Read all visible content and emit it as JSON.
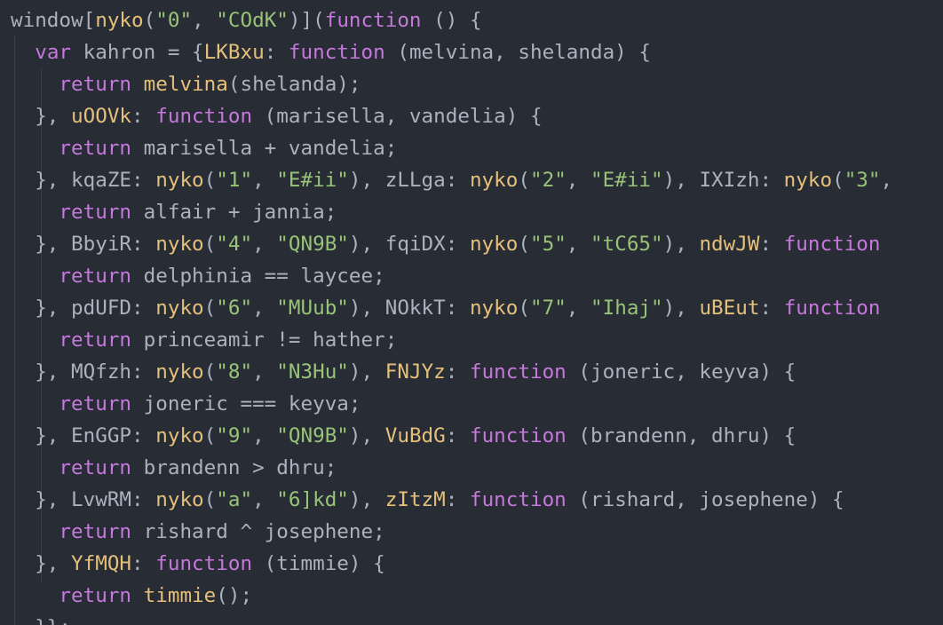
{
  "editor": {
    "language": "javascript",
    "theme_colors": {
      "background": "#282c34",
      "plain": "#abb2bf",
      "keyword": "#c678dd",
      "function_call": "#e5c07b",
      "string": "#98c379"
    },
    "lines": [
      [
        [
          "plain",
          "window["
        ],
        [
          "fn",
          "nyko"
        ],
        [
          "punc",
          "("
        ],
        [
          "str",
          "\"0\""
        ],
        [
          "punc",
          ", "
        ],
        [
          "str",
          "\"COdK\""
        ],
        [
          "punc",
          ")]("
        ],
        [
          "kw",
          "function"
        ],
        [
          "punc",
          " () {"
        ]
      ],
      [
        [
          "plain",
          "  "
        ],
        [
          "kw",
          "var"
        ],
        [
          "plain",
          " kahron = {"
        ],
        [
          "prop",
          "LKBxu"
        ],
        [
          "punc",
          ": "
        ],
        [
          "kw",
          "function"
        ],
        [
          "plain",
          " (melvina, shelanda) {"
        ]
      ],
      [
        [
          "plain",
          "    "
        ],
        [
          "kw",
          "return"
        ],
        [
          "plain",
          " "
        ],
        [
          "fn",
          "melvina"
        ],
        [
          "plain",
          "(shelanda);"
        ]
      ],
      [
        [
          "plain",
          "  }, "
        ],
        [
          "prop",
          "uOOVk"
        ],
        [
          "punc",
          ": "
        ],
        [
          "kw",
          "function"
        ],
        [
          "plain",
          " (marisella, vandelia) {"
        ]
      ],
      [
        [
          "plain",
          "    "
        ],
        [
          "kw",
          "return"
        ],
        [
          "plain",
          " marisella + vandelia;"
        ]
      ],
      [
        [
          "plain",
          "  }, kqaZE: "
        ],
        [
          "fn",
          "nyko"
        ],
        [
          "punc",
          "("
        ],
        [
          "str",
          "\"1\""
        ],
        [
          "punc",
          ", "
        ],
        [
          "str",
          "\"E#ii\""
        ],
        [
          "punc",
          "), zLLga: "
        ],
        [
          "fn",
          "nyko"
        ],
        [
          "punc",
          "("
        ],
        [
          "str",
          "\"2\""
        ],
        [
          "punc",
          ", "
        ],
        [
          "str",
          "\"E#ii\""
        ],
        [
          "punc",
          "), IXIzh: "
        ],
        [
          "fn",
          "nyko"
        ],
        [
          "punc",
          "("
        ],
        [
          "str",
          "\"3\""
        ],
        [
          "punc",
          ","
        ]
      ],
      [
        [
          "plain",
          "    "
        ],
        [
          "kw",
          "return"
        ],
        [
          "plain",
          " alfair + jannia;"
        ]
      ],
      [
        [
          "plain",
          "  }, BbyiR: "
        ],
        [
          "fn",
          "nyko"
        ],
        [
          "punc",
          "("
        ],
        [
          "str",
          "\"4\""
        ],
        [
          "punc",
          ", "
        ],
        [
          "str",
          "\"QN9B\""
        ],
        [
          "punc",
          "), fqiDX: "
        ],
        [
          "fn",
          "nyko"
        ],
        [
          "punc",
          "("
        ],
        [
          "str",
          "\"5\""
        ],
        [
          "punc",
          ", "
        ],
        [
          "str",
          "\"tC65\""
        ],
        [
          "punc",
          "), "
        ],
        [
          "prop",
          "ndwJW"
        ],
        [
          "punc",
          ": "
        ],
        [
          "kw",
          "function"
        ]
      ],
      [
        [
          "plain",
          "    "
        ],
        [
          "kw",
          "return"
        ],
        [
          "plain",
          " delphinia == laycee;"
        ]
      ],
      [
        [
          "plain",
          "  }, pdUFD: "
        ],
        [
          "fn",
          "nyko"
        ],
        [
          "punc",
          "("
        ],
        [
          "str",
          "\"6\""
        ],
        [
          "punc",
          ", "
        ],
        [
          "str",
          "\"MUub\""
        ],
        [
          "punc",
          "), NOkkT: "
        ],
        [
          "fn",
          "nyko"
        ],
        [
          "punc",
          "("
        ],
        [
          "str",
          "\"7\""
        ],
        [
          "punc",
          ", "
        ],
        [
          "str",
          "\"Ihaj\""
        ],
        [
          "punc",
          "), "
        ],
        [
          "prop",
          "uBEut"
        ],
        [
          "punc",
          ": "
        ],
        [
          "kw",
          "function"
        ]
      ],
      [
        [
          "plain",
          "    "
        ],
        [
          "kw",
          "return"
        ],
        [
          "plain",
          " princeamir != hather;"
        ]
      ],
      [
        [
          "plain",
          "  }, MQfzh: "
        ],
        [
          "fn",
          "nyko"
        ],
        [
          "punc",
          "("
        ],
        [
          "str",
          "\"8\""
        ],
        [
          "punc",
          ", "
        ],
        [
          "str",
          "\"N3Hu\""
        ],
        [
          "punc",
          "), "
        ],
        [
          "prop",
          "FNJYz"
        ],
        [
          "punc",
          ": "
        ],
        [
          "kw",
          "function"
        ],
        [
          "plain",
          " (joneric, keyva) {"
        ]
      ],
      [
        [
          "plain",
          "    "
        ],
        [
          "kw",
          "return"
        ],
        [
          "plain",
          " joneric === keyva;"
        ]
      ],
      [
        [
          "plain",
          "  }, EnGGP: "
        ],
        [
          "fn",
          "nyko"
        ],
        [
          "punc",
          "("
        ],
        [
          "str",
          "\"9\""
        ],
        [
          "punc",
          ", "
        ],
        [
          "str",
          "\"QN9B\""
        ],
        [
          "punc",
          "), "
        ],
        [
          "prop",
          "VuBdG"
        ],
        [
          "punc",
          ": "
        ],
        [
          "kw",
          "function"
        ],
        [
          "plain",
          " (brandenn, dhru) {"
        ]
      ],
      [
        [
          "plain",
          "    "
        ],
        [
          "kw",
          "return"
        ],
        [
          "plain",
          " brandenn > dhru;"
        ]
      ],
      [
        [
          "plain",
          "  }, LvwRM: "
        ],
        [
          "fn",
          "nyko"
        ],
        [
          "punc",
          "("
        ],
        [
          "str",
          "\"a\""
        ],
        [
          "punc",
          ", "
        ],
        [
          "str",
          "\"6]kd\""
        ],
        [
          "punc",
          "), "
        ],
        [
          "prop",
          "zItzM"
        ],
        [
          "punc",
          ": "
        ],
        [
          "kw",
          "function"
        ],
        [
          "plain",
          " (rishard, josephene) {"
        ]
      ],
      [
        [
          "plain",
          "    "
        ],
        [
          "kw",
          "return"
        ],
        [
          "plain",
          " rishard ^ josephene;"
        ]
      ],
      [
        [
          "plain",
          "  }, "
        ],
        [
          "prop",
          "YfMQH"
        ],
        [
          "punc",
          ": "
        ],
        [
          "kw",
          "function"
        ],
        [
          "plain",
          " (timmie) {"
        ]
      ],
      [
        [
          "plain",
          "    "
        ],
        [
          "kw",
          "return"
        ],
        [
          "plain",
          " "
        ],
        [
          "fn",
          "timmie"
        ],
        [
          "plain",
          "();"
        ]
      ],
      [
        [
          "plain",
          "  }};"
        ]
      ]
    ]
  }
}
